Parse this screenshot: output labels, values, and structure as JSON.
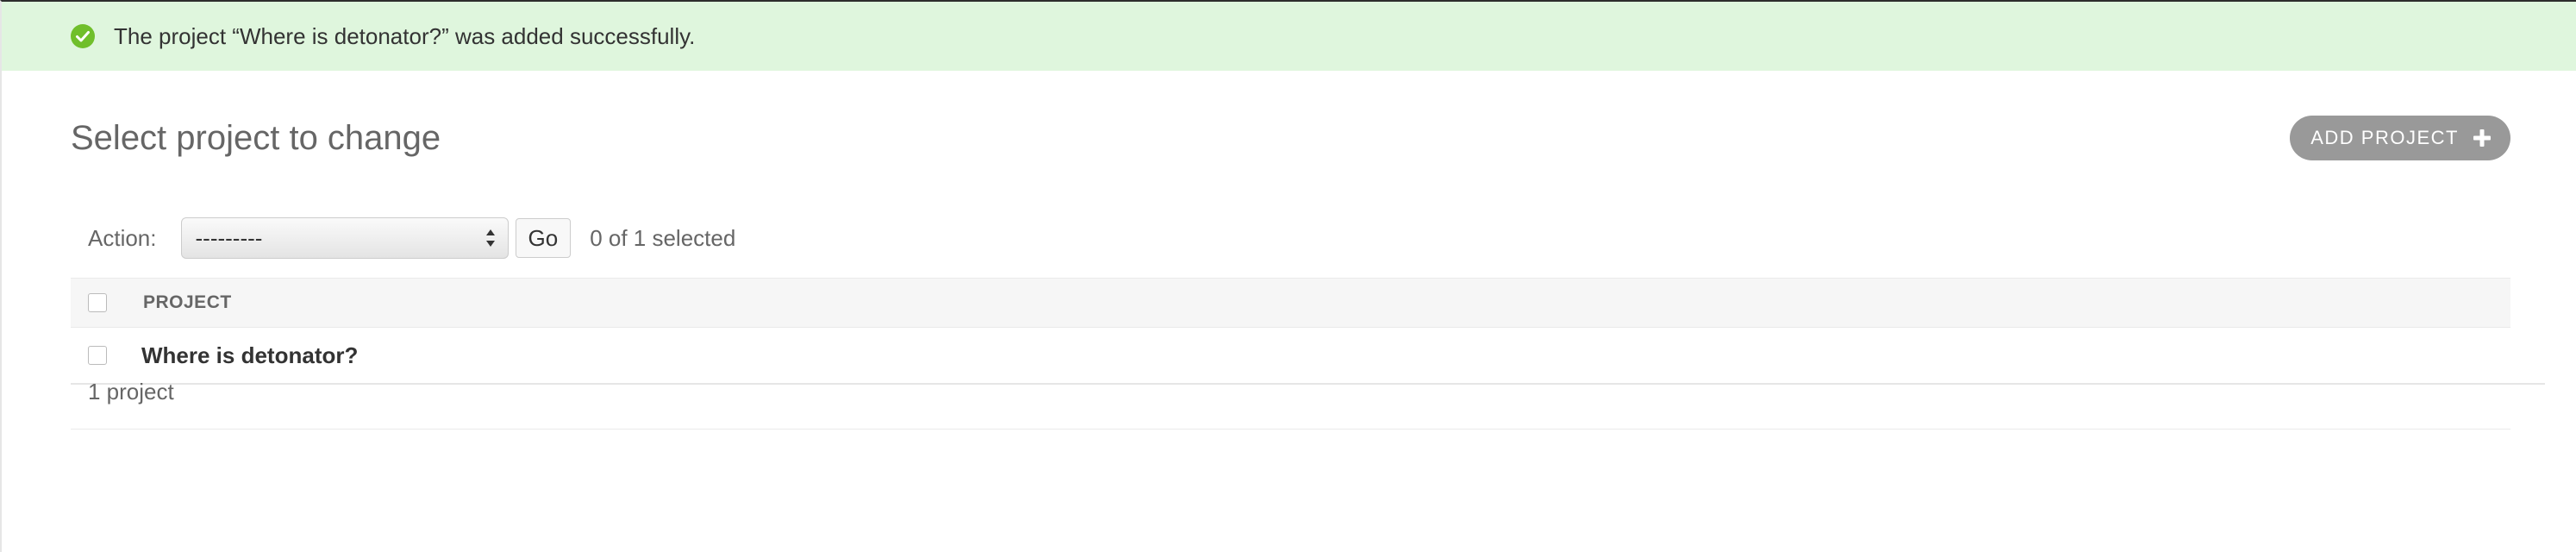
{
  "message": {
    "text": "The project “Where is detonator?” was added successfully.",
    "icon": "check-circle-icon",
    "color": "#dff6dd"
  },
  "page": {
    "title": "Select project to change"
  },
  "toolbar": {
    "add_label": "ADD PROJECT",
    "add_icon": "plus-icon"
  },
  "actions": {
    "label": "Action:",
    "selected_value": "---------",
    "go_label": "Go",
    "selection_count": "0 of 1 selected"
  },
  "table": {
    "columns": [
      "PROJECT"
    ],
    "rows": [
      {
        "project": "Where is detonator?"
      }
    ]
  },
  "paginator": {
    "text": "1 project"
  },
  "colors": {
    "success_bg": "#dff6dd",
    "success_icon": "#70bf2b",
    "button_bg": "#999999"
  }
}
